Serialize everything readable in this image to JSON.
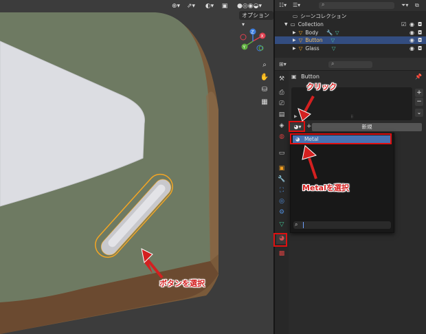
{
  "viewport": {
    "options_label": "オプション",
    "options_arrow": "▾",
    "tools": [
      "zoom-icon",
      "hand-icon",
      "camera-icon",
      "grid-icon"
    ],
    "gizmo": {
      "x": "X",
      "y": "Y",
      "z": "Z"
    }
  },
  "outliner": {
    "header_title": "シーンコレクション",
    "items": [
      {
        "label": "Collection"
      },
      {
        "label": "Body"
      },
      {
        "label": "Button",
        "selected": true
      },
      {
        "label": "Glass"
      }
    ]
  },
  "properties": {
    "object_name": "Button",
    "material_new_label": "新規",
    "material_slot_add": "+",
    "slot_side_buttons": [
      "+",
      "−",
      "⌄"
    ],
    "dropdown": {
      "items": [
        {
          "label": "Metal"
        }
      ]
    }
  },
  "annotations": {
    "click": "クリック",
    "select_metal": "Metalを選択",
    "select_button": "ボタンを選択"
  },
  "colors": {
    "accent_red": "#e01010",
    "selection_blue": "#334d80",
    "object_orange": "#f5a623",
    "dropdown_highlight": "#4772b3"
  }
}
